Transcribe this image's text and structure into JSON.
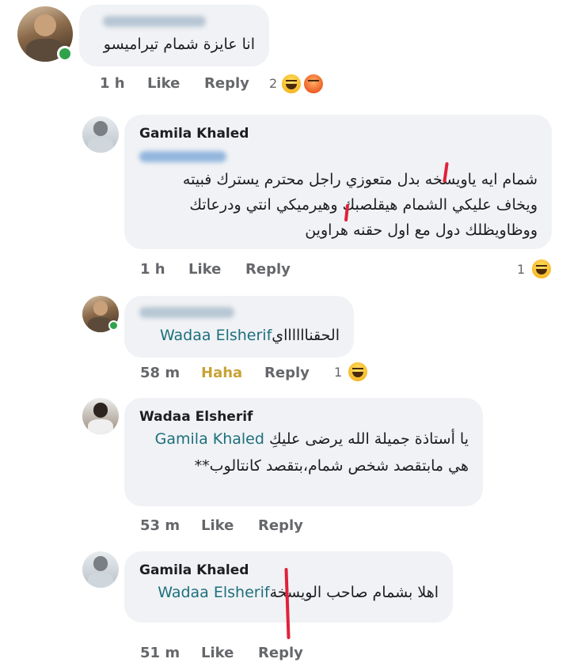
{
  "comments": [
    {
      "author": "",
      "text": "انا عايزة شمام تيراميسو",
      "time": "1 h",
      "like_label": "Like",
      "reply_label": "Reply",
      "reaction_count": "2",
      "reactions": [
        "haha-emoji-icon",
        "angry-emoji-icon"
      ]
    },
    {
      "author": "Gamila Khaled",
      "lines": [
        "شمام ايه ياويسخه بدل متعوزي راجل محترم يسترك فبيته",
        "ويخاف عليكي الشمام هيقلصبك وهيرميكي انتي ودرعاتك",
        "ووظاويظلك دول مع اول حقنه هراوين"
      ],
      "time": "1 h",
      "like_label": "Like",
      "reply_label": "Reply",
      "reaction_count": "1",
      "reactions": [
        "haha-emoji-icon"
      ]
    },
    {
      "author": "",
      "mention": "Wadaa Elsherif",
      "text": "الحقنااااااي",
      "time": "58 m",
      "like_label": "Haha",
      "reply_label": "Reply",
      "reaction_count": "1",
      "reactions": [
        "haha-emoji-icon"
      ]
    },
    {
      "author": "Wadaa Elsherif",
      "mention": "Gamila Khaled",
      "line1": "يا أستاذة جميلة الله يرضى عليكِ",
      "line2": "هي مابتقصد شخص شمام،بتقصد كانتالوب**",
      "time": "53 m",
      "like_label": "Like",
      "reply_label": "Reply"
    },
    {
      "author": "Gamila Khaled",
      "mention": "Wadaa Elsherif",
      "text": "اهلا بشمام صاحب الويسخة",
      "time": "51 m",
      "like_label": "Like",
      "reply_label": "Reply"
    }
  ],
  "colors": {
    "bubble": "#f0f2f5",
    "mention": "#216fdb",
    "meta": "#65676b",
    "online": "#31a24c",
    "annotation": "#e0213a"
  }
}
